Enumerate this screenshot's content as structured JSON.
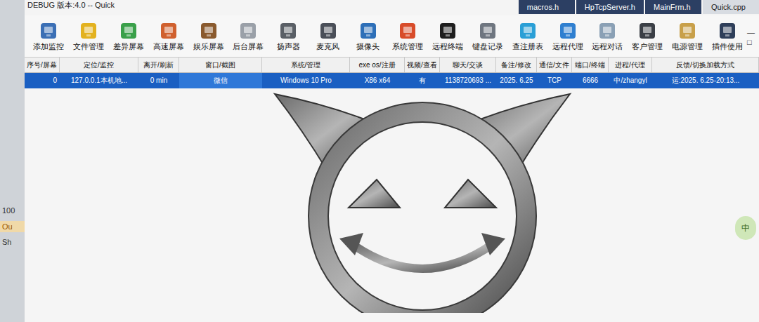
{
  "window": {
    "title": "DEBUG 版本:4.0 -- Quick",
    "controls": [
      "—",
      "□"
    ]
  },
  "editor_tabs": [
    {
      "label": "macros.h",
      "selected": false
    },
    {
      "label": "HpTcpServer.h",
      "selected": false
    },
    {
      "label": "MainFrm.h",
      "selected": false
    },
    {
      "label": "Quick.cpp",
      "selected": true
    }
  ],
  "toolbar": [
    {
      "label": "添加监控"
    },
    {
      "label": "文件管理"
    },
    {
      "label": "差异屏幕"
    },
    {
      "label": "高速屏幕"
    },
    {
      "label": "娱乐屏幕"
    },
    {
      "label": "后台屏幕"
    },
    {
      "label": "扬声器"
    },
    {
      "label": "麦克风"
    },
    {
      "label": "摄像头"
    },
    {
      "label": "系统管理"
    },
    {
      "label": "远程终端"
    },
    {
      "label": "键盘记录"
    },
    {
      "label": "查注册表"
    },
    {
      "label": "远程代理"
    },
    {
      "label": "远程对话"
    },
    {
      "label": "客户管理"
    },
    {
      "label": "电源管理"
    },
    {
      "label": "插件使用"
    }
  ],
  "table": {
    "columns": [
      "序号/屏幕",
      "定位/监控",
      "离开/刷新",
      "窗口/截图",
      "系统/管理",
      "exe os/注册",
      "视频/查看",
      "聊天/交谈",
      "备注/修改",
      "通信/文件",
      "端口/终端",
      "进程/代理",
      "反馈/切换加载方式"
    ],
    "rows": [
      {
        "selected": true,
        "cells": [
          "0",
          "127.0.0.1本机地...",
          "0 min",
          "微信",
          "Windows 10 Pro",
          "X86 x64",
          "有",
          "1138720693 ...",
          "2025. 6.25",
          "TCP",
          "6666",
          "中/zhangyl",
          "运:2025. 6.25-20:13..."
        ]
      }
    ]
  },
  "background_panel": {
    "lines": [
      "100",
      "Ou",
      "Sh"
    ]
  },
  "ime_badge": "中"
}
